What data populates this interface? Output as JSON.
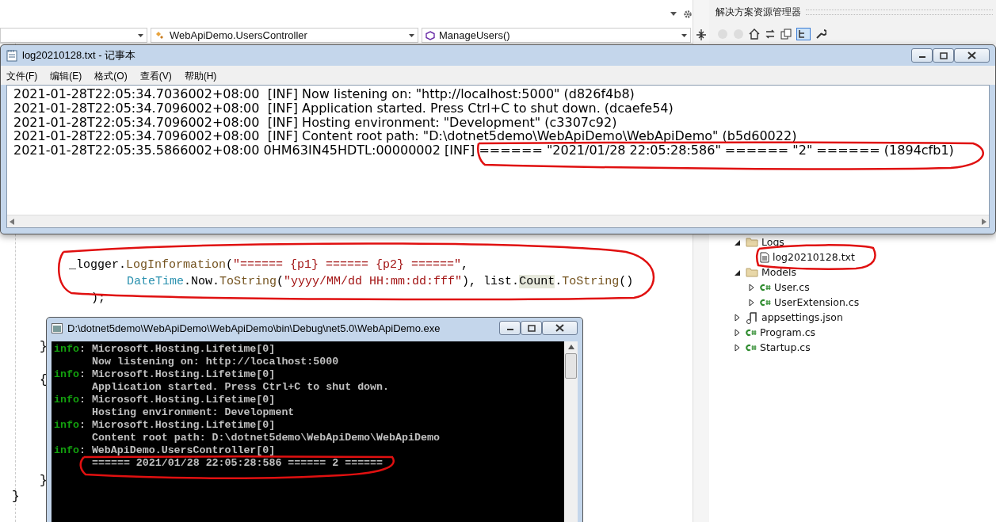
{
  "ide": {
    "nav_bar": {
      "type_dropdown": "WebApiDemo.UsersController",
      "member_dropdown": "ManageUsers()"
    },
    "code_lines": [
      {
        "kind": "statement",
        "tokens": [
          {
            "kind": "plain",
            "text": "_logger."
          },
          {
            "kind": "method",
            "text": "LogInformation"
          },
          {
            "kind": "plain",
            "text": "("
          },
          {
            "kind": "string",
            "text": "\"====== {p1} ====== {p2} ======\""
          },
          {
            "kind": "plain",
            "text": ","
          }
        ]
      },
      {
        "kind": "continuation",
        "tokens": [
          {
            "kind": "type",
            "text": "DateTime"
          },
          {
            "kind": "plain",
            "text": ".Now."
          },
          {
            "kind": "method",
            "text": "ToString"
          },
          {
            "kind": "plain",
            "text": "("
          },
          {
            "kind": "string",
            "text": "\"yyyy/MM/dd HH:mm:dd:fff\""
          },
          {
            "kind": "plain",
            "text": "), list."
          },
          {
            "kind": "highlight",
            "text": "Count"
          },
          {
            "kind": "plain",
            "text": "."
          },
          {
            "kind": "method",
            "text": "ToString"
          },
          {
            "kind": "plain",
            "text": "()"
          }
        ]
      },
      {
        "kind": "closing",
        "tokens": [
          {
            "kind": "plain",
            "text": ");"
          }
        ]
      }
    ],
    "braces": [
      {
        "kind": "method_end",
        "text": "}"
      },
      {
        "kind": "block_start",
        "text": "{"
      },
      {
        "kind": "block_end",
        "text": "}"
      },
      {
        "kind": "class_end",
        "text": "}"
      }
    ]
  },
  "solution_explorer": {
    "title": "解决方案资源管理器",
    "tree": [
      {
        "label": "Logs",
        "kind": "folder",
        "expanded": true,
        "children": [
          {
            "label": "log20210128.txt",
            "kind": "text"
          }
        ]
      },
      {
        "label": "Models",
        "kind": "folder",
        "expanded": true,
        "children": [
          {
            "label": "User.cs",
            "kind": "csharp",
            "expanded": false
          },
          {
            "label": "UserExtension.cs",
            "kind": "csharp",
            "expanded": false
          }
        ]
      },
      {
        "label": "appsettings.json",
        "kind": "settings",
        "expanded": false
      },
      {
        "label": "Program.cs",
        "kind": "csharp",
        "expanded": false
      },
      {
        "label": "Startup.cs",
        "kind": "csharp",
        "expanded": false
      }
    ]
  },
  "notepad": {
    "title": "log20210128.txt - 记事本",
    "menus": [
      "文件(F)",
      "编辑(E)",
      "格式(O)",
      "查看(V)",
      "帮助(H)"
    ],
    "lines": [
      "2021-01-28T22:05:34.7036002+08:00  [INF] Now listening on: \"http://localhost:5000\" (d826f4b8)",
      "2021-01-28T22:05:34.7096002+08:00  [INF] Application started. Press Ctrl+C to shut down. (dcaefe54)",
      "2021-01-28T22:05:34.7096002+08:00  [INF] Hosting environment: \"Development\" (c3307c92)",
      "2021-01-28T22:05:34.7096002+08:00  [INF] Content root path: \"D:\\dotnet5demo\\WebApiDemo\\WebApiDemo\" (b5d60022)",
      "2021-01-28T22:05:35.5866002+08:00 0HM63IN45HDTL:00000002 [INF] ====== \"2021/01/28 22:05:28:586\" ====== \"2\" ====== (1894cfb1)"
    ]
  },
  "console": {
    "title": "D:\\dotnet5demo\\WebApiDemo\\WebApiDemo\\bin\\Debug\\net5.0\\WebApiDemo.exe",
    "lines": [
      {
        "kind": "header",
        "level_tag": "info",
        "text": ": Microsoft.Hosting.Lifetime[0]"
      },
      {
        "kind": "message",
        "text": "Now listening on: http://localhost:5000"
      },
      {
        "kind": "header",
        "level_tag": "info",
        "text": ": Microsoft.Hosting.Lifetime[0]"
      },
      {
        "kind": "message",
        "text": "Application started. Press Ctrl+C to shut down."
      },
      {
        "kind": "header",
        "level_tag": "info",
        "text": ": Microsoft.Hosting.Lifetime[0]"
      },
      {
        "kind": "message",
        "text": "Hosting environment: Development"
      },
      {
        "kind": "header",
        "level_tag": "info",
        "text": ": Microsoft.Hosting.Lifetime[0]"
      },
      {
        "kind": "message",
        "text": "Content root path: D:\\dotnet5demo\\WebApiDemo\\WebApiDemo"
      },
      {
        "kind": "header",
        "level_tag": "info",
        "text": ": WebApiDemo.UsersController[0]"
      },
      {
        "kind": "message",
        "text": "====== 2021/01/28 22:05:28:586 ====== 2 ======"
      }
    ]
  }
}
